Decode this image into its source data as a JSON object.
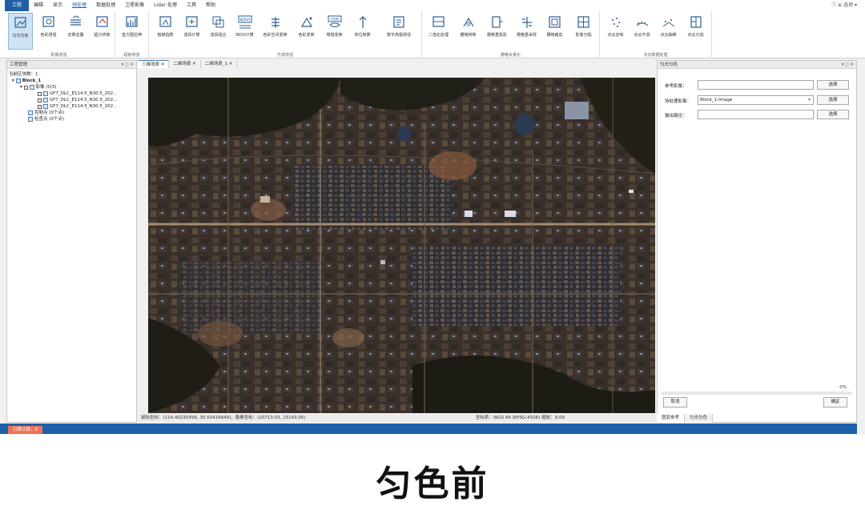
{
  "menu": {
    "file_label": "工程",
    "items": [
      "编辑",
      "显示",
      "预处理",
      "数据处理",
      "卫星影像",
      "Lidar 处理",
      "工具",
      "帮助"
    ],
    "active_index": 2,
    "right_label": "ⓘ ⊕ 选项 ▾"
  },
  "ribbon": {
    "groups": [
      {
        "label": "影像增强",
        "buttons": [
          "匀光匀色",
          "色彩增强",
          "去雾去霾",
          "超分辨率"
        ]
      },
      {
        "label": "辐射增强",
        "buttons": [
          "直方图拉伸"
        ]
      },
      {
        "label": "光谱增强",
        "buttons": [
          "植被指数",
          "波段计算",
          "波段组合",
          "NDVI计算",
          "色彩空间变换",
          "色彩变换",
          "缨帽变换",
          "单位换算",
          "数字高程增强"
        ]
      },
      {
        "label": "栅格矢量化",
        "buttons": [
          "二值化处理",
          "栅格转换",
          "栅格重投影",
          "栅格重采样",
          "栅格裁剪",
          "影像分幅"
        ]
      },
      {
        "label": "点云数据处理",
        "buttons": [
          "点云去噪",
          "点云平滑",
          "点云抽稀",
          "点云分割"
        ]
      }
    ],
    "active_button": "匀光匀色"
  },
  "left_panel": {
    "title": "工程管理",
    "subtitle": "当前区块数：1",
    "tree": [
      {
        "label": "Block_1",
        "level": 0
      },
      {
        "label": "影像 (0/3)",
        "level": 1
      },
      {
        "label": "GF7_DLC_E114.5_N30.5_202...",
        "level": 2
      },
      {
        "label": "GF7_DLC_E114.5_N30.5_202...",
        "level": 2
      },
      {
        "label": "GF7_DLC_E114.5_N30.5_202...",
        "level": 2
      },
      {
        "label": "控制点 (0个点)",
        "level": 1
      },
      {
        "label": "检查点 (0个点)",
        "level": 1
      }
    ]
  },
  "tabs": [
    {
      "label": "三维场景 ✕",
      "active": true
    },
    {
      "label": "二维场景 ✕",
      "active": false
    },
    {
      "label": "二维场景_1 ✕",
      "active": false
    }
  ],
  "status": {
    "mouse": "鼠标坐标：(114.40235456, 30.50416649)，像素坐标：(20713.03, 15143.05)",
    "crs": "坐标系：WGS 84 (EPSG:4326) 缩放：9.09"
  },
  "right_panel": {
    "title": "匀光匀色",
    "ref_label": "参考影像：",
    "ref_value": "",
    "pending_label": "待处理影像：",
    "pending_value": "Block_1-Image",
    "output_label": "输出路径：",
    "output_value": "",
    "browse_label": "选择",
    "progress_text": "0%",
    "progress": 0,
    "cancel_label": "取消",
    "ok_label": "确定"
  },
  "right_tabs": [
    {
      "label": "图层参考",
      "active": true
    },
    {
      "label": "匀光匀色",
      "active": false
    }
  ],
  "bottom": {
    "badge": "引擎计算：0"
  },
  "caption": "匀色前"
}
